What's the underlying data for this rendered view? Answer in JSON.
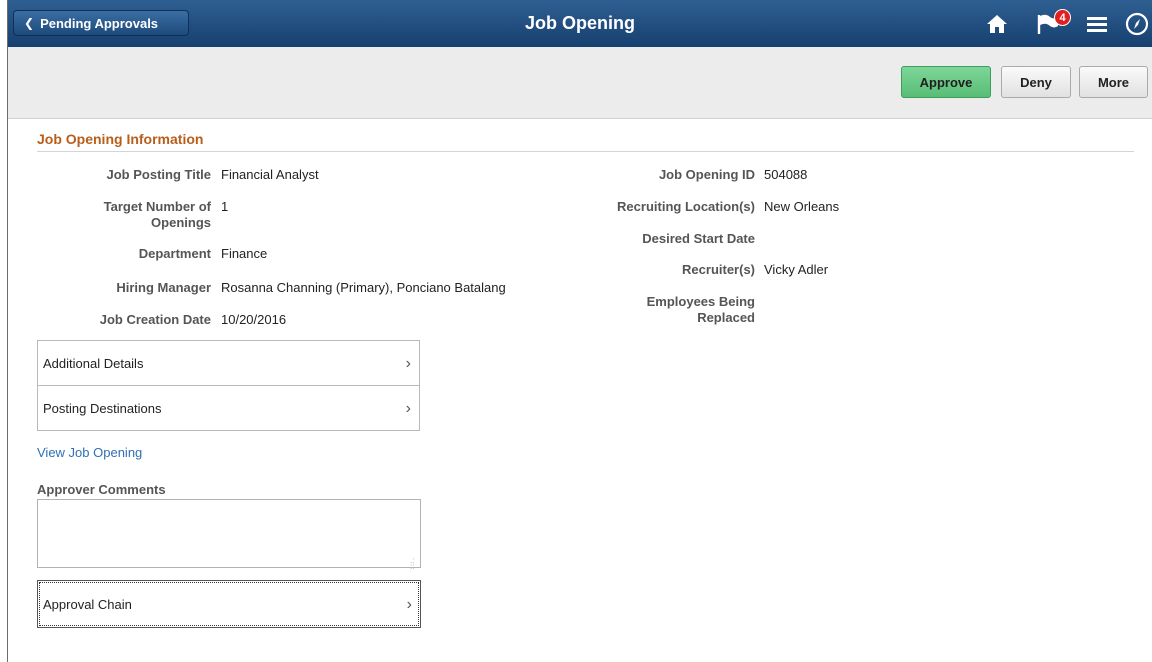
{
  "header": {
    "back_label": "Pending Approvals",
    "title": "Job Opening",
    "notification_count": "4"
  },
  "toolbar": {
    "approve_label": "Approve",
    "deny_label": "Deny",
    "more_label": "More"
  },
  "section": {
    "title": "Job Opening Information"
  },
  "fields_left": [
    {
      "label": "Job Posting Title",
      "value": "Financial Analyst"
    },
    {
      "label": "Target Number of Openings",
      "value": "1"
    },
    {
      "label": "Department",
      "value": "Finance"
    },
    {
      "label": "Hiring Manager",
      "value": "Rosanna Channing (Primary), Ponciano Batalang"
    },
    {
      "label": "Job Creation Date",
      "value": "10/20/2016"
    }
  ],
  "fields_right": [
    {
      "label": "Job Opening ID",
      "value": "504088"
    },
    {
      "label": "Recruiting Location(s)",
      "value": "New Orleans"
    },
    {
      "label": "Desired Start Date",
      "value": ""
    },
    {
      "label": "Recruiter(s)",
      "value": "Vicky Adler"
    },
    {
      "label": "Employees Being Replaced",
      "value": ""
    }
  ],
  "group_items": [
    {
      "label": "Additional Details"
    },
    {
      "label": "Posting Destinations"
    }
  ],
  "view_link": "View Job Opening",
  "comments": {
    "label": "Approver Comments",
    "value": ""
  },
  "approval_chain_label": "Approval Chain",
  "colors": {
    "header_bg": "#1f4a7a",
    "section_title": "#b85e1b",
    "approve_bg": "#6ccb87",
    "link": "#2f6fb5"
  }
}
